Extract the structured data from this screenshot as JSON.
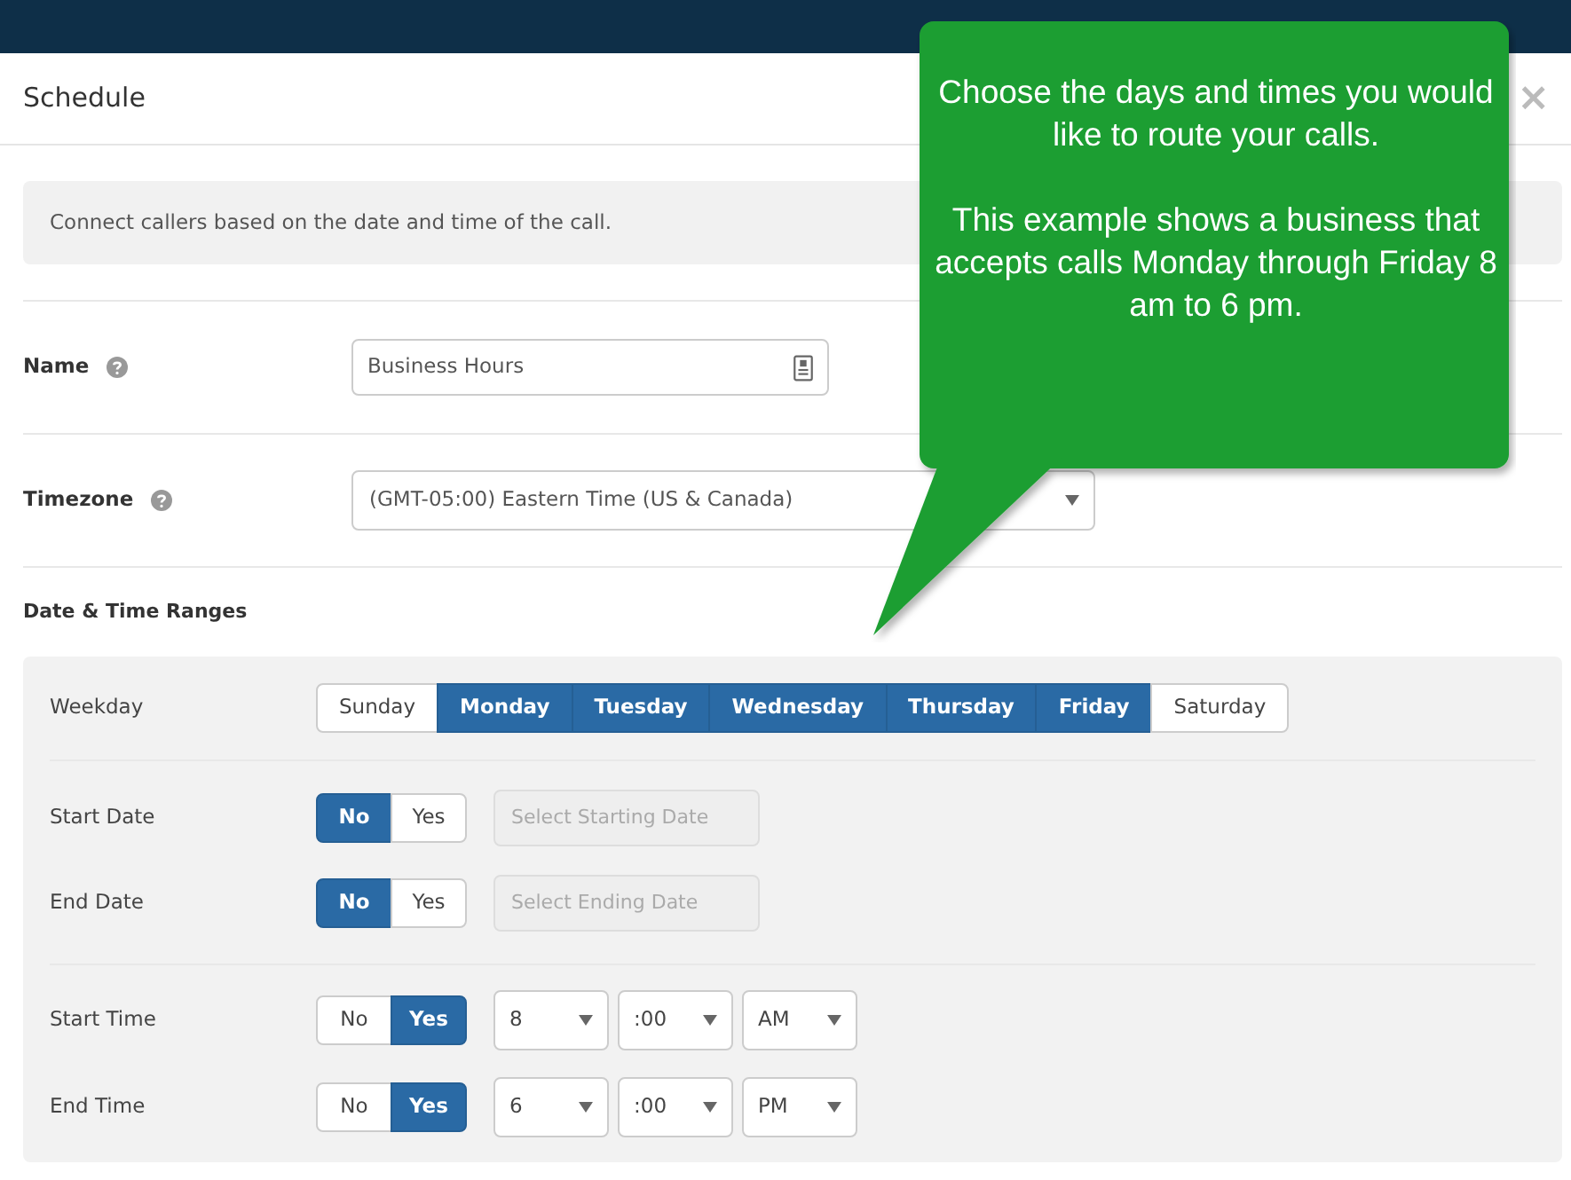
{
  "window": {
    "title": "Schedule",
    "close": "×"
  },
  "info": "Connect callers based on the date and time of the call.",
  "fields": [
    {
      "kind": "text",
      "label": "Name",
      "value": "Business Hours"
    },
    {
      "kind": "select",
      "label": "Timezone",
      "value": "(GMT-05:00) Eastern Time (US & Canada)"
    }
  ],
  "section_title": "Date & Time Ranges",
  "weekday": {
    "label": "Weekday",
    "days": [
      {
        "label": "Sunday",
        "selected": false
      },
      {
        "label": "Monday",
        "selected": true
      },
      {
        "label": "Tuesday",
        "selected": true
      },
      {
        "label": "Wednesday",
        "selected": true
      },
      {
        "label": "Thursday",
        "selected": true
      },
      {
        "label": "Friday",
        "selected": true
      },
      {
        "label": "Saturday",
        "selected": false
      }
    ]
  },
  "date_rows": [
    {
      "label": "Start Date",
      "options": [
        {
          "label": "No",
          "selected": true
        },
        {
          "label": "Yes",
          "selected": false
        }
      ],
      "placeholder": "Select Starting Date",
      "disabled": true
    },
    {
      "label": "End Date",
      "options": [
        {
          "label": "No",
          "selected": true
        },
        {
          "label": "Yes",
          "selected": false
        }
      ],
      "placeholder": "Select Ending Date",
      "disabled": true
    }
  ],
  "time_rows": [
    {
      "label": "Start Time",
      "options": [
        {
          "label": "No",
          "selected": false
        },
        {
          "label": "Yes",
          "selected": true
        }
      ],
      "hour": "8",
      "minute": ":00",
      "period": "AM"
    },
    {
      "label": "End Time",
      "options": [
        {
          "label": "No",
          "selected": false
        },
        {
          "label": "Yes",
          "selected": true
        }
      ],
      "hour": "6",
      "minute": ":00",
      "period": "PM"
    }
  ],
  "callout": {
    "paragraphs": [
      "Choose the days and times you would like to route your calls.",
      "This example shows a business that accepts calls Monday through Friday 8 am to 6 pm."
    ]
  }
}
